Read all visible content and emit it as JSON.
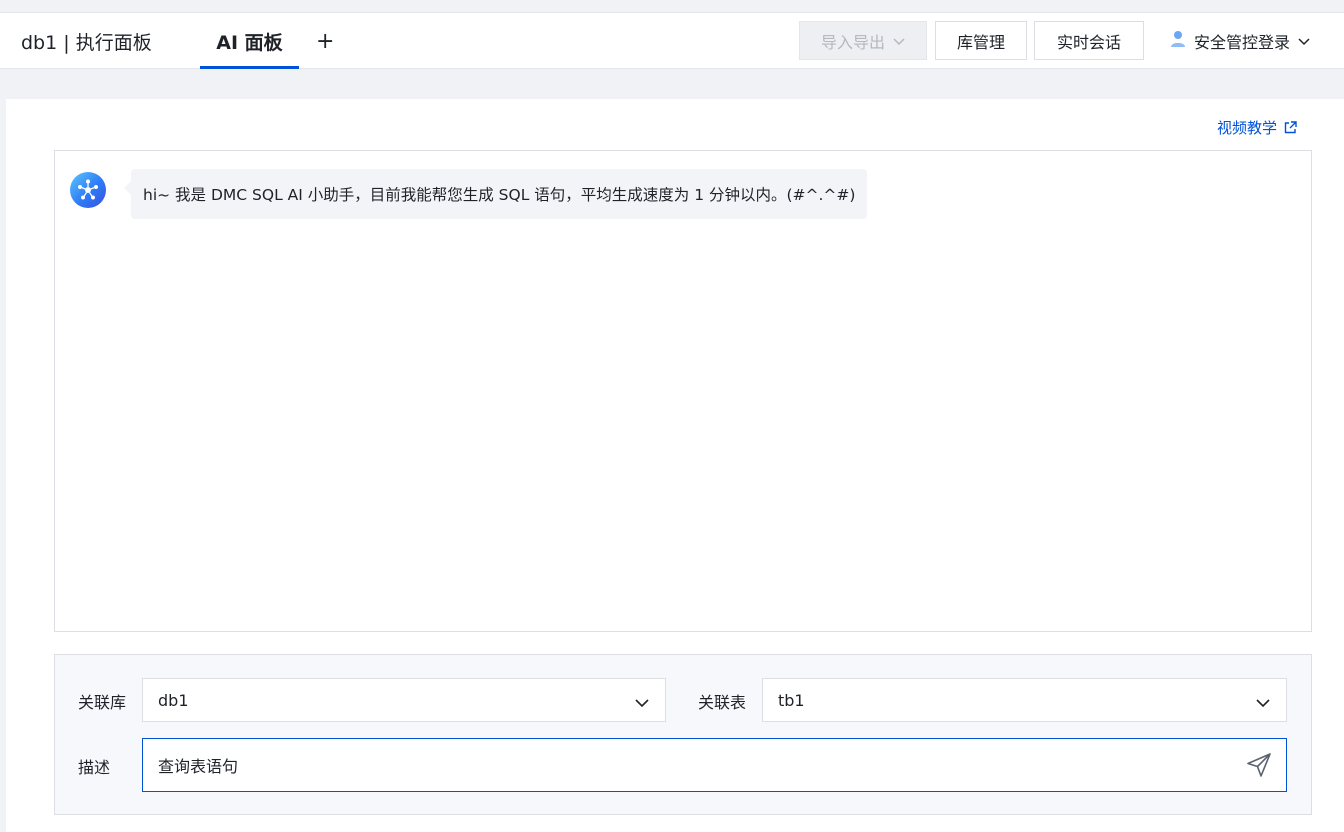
{
  "header": {
    "tabs": [
      {
        "label": "db1 | 执行面板",
        "active": false
      },
      {
        "label": "AI 面板",
        "active": true
      }
    ],
    "add_tab_label": "+",
    "buttons": {
      "import_export": "导入导出",
      "library_manage": "库管理",
      "live_session": "实时会话"
    },
    "user_menu_label": "安全管控登录"
  },
  "panel": {
    "video_tutorial_link": "视频教学",
    "chat": {
      "messages": [
        {
          "role": "assistant",
          "text": "hi~ 我是 DMC SQL AI 小助手，目前我能帮您生成 SQL 语句，平均生成速度为 1 分钟以内。(#^.^#)"
        }
      ]
    },
    "form": {
      "database_label": "关联库",
      "database_value": "db1",
      "table_label": "关联表",
      "table_value": "tb1",
      "description_label": "描述",
      "description_value": "查询表语句"
    }
  },
  "colors": {
    "accent": "#0052d9",
    "page_background": "#f1f2f5",
    "disabled_text": "#b4b8bf"
  },
  "icons": [
    "chevron-down-icon",
    "user-icon",
    "external-link-icon",
    "assistant-avatar-icon",
    "send-icon"
  ]
}
